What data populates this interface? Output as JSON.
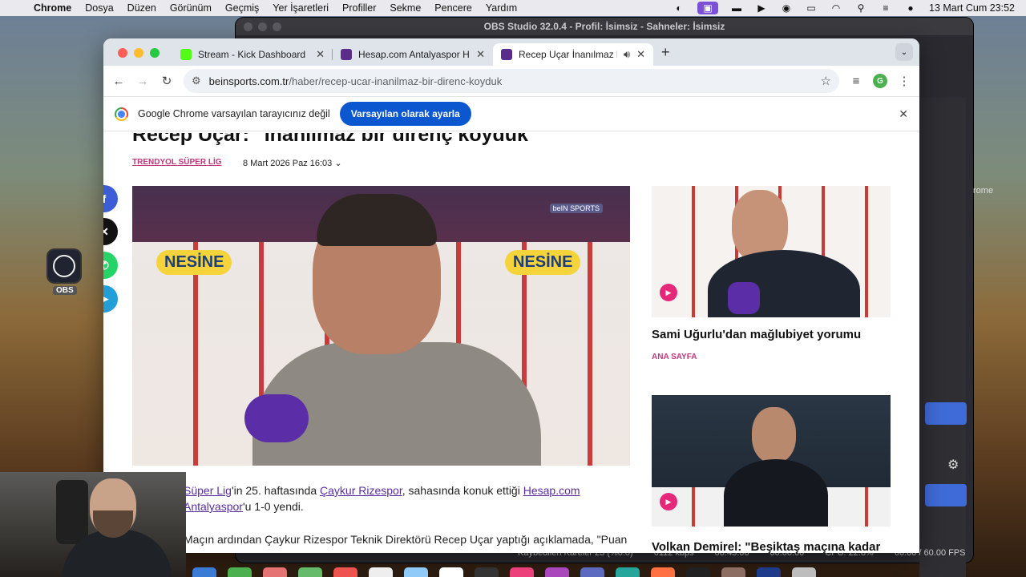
{
  "menubar": {
    "app": "Chrome",
    "items": [
      "Dosya",
      "Düzen",
      "Görünüm",
      "Geçmiş",
      "Yer İşaretleri",
      "Profiller",
      "Sekme",
      "Pencere",
      "Yardım"
    ],
    "datetime": "13 Mart Cum  23:52"
  },
  "obs": {
    "title": "OBS Studio 32.0.4 - Profil: İsimsiz - Sahneler: İsimsiz",
    "source_label": "rome",
    "status": {
      "dropped": "Kaybedilen Kareler 23 (%0.0)",
      "bitrate": "6112 kbps",
      "time": "00:43:06",
      "rec_time": "00:00:00",
      "cpu": "CPU: 22.8%",
      "fps": "60.00 / 60.00 FPS"
    },
    "desktop_icon_label": "OBS"
  },
  "tabs": [
    {
      "title": "Stream - Kick Dashboard",
      "favicon_color": "#53fc18"
    },
    {
      "title": "Hesap.com Antalyaspor Habe",
      "favicon_color": "#5b2d8a"
    },
    {
      "title": "Recep Uçar İnanılmaz bir",
      "favicon_color": "#5b2d8a"
    }
  ],
  "toolbar": {
    "url_host": "beinsports.com.tr",
    "url_path": "/haber/recep-ucar-inanilmaz-bir-direnc-koyduk",
    "profile_initial": "G"
  },
  "infobar": {
    "message": "Google Chrome varsayılan tarayıcınız değil",
    "button": "Varsayılan olarak ayarla"
  },
  "article": {
    "headline": "Recep Uçar: \"İnanılmaz bir direnç koyduk\"",
    "category": "TRENDYOL SÜPER LİG",
    "date": "8 Mart 2026 Paz 16:03",
    "main_image_sponsor": "NESİNE",
    "main_image_tag": "beIN SPORTS",
    "p1_link1": "Süper Lig",
    "p1_text1": "'in 25. haftasında ",
    "p1_link2": "Çaykur Rizespor",
    "p1_text2": ", sahasında konuk ettiği ",
    "p1_link3": "Hesap.com",
    "p2_link": "Antalyaspor",
    "p2_text": "'u 1-0 yendi.",
    "p3_text": "Maçın ardından Çaykur Rizespor Teknik Direktörü Recep Uçar yaptığı açıklamada, \"Puan"
  },
  "sidebar": [
    {
      "title": "Sami Uğurlu'dan mağlubiyet yorumu",
      "category": "ANA SAYFA"
    },
    {
      "title": "Volkan Demirel: \"Beşiktaş maçına kadar",
      "category": ""
    }
  ],
  "share_icons": [
    "facebook-icon",
    "x-icon",
    "whatsapp-icon",
    "telegram-icon"
  ],
  "colors": {
    "accent_blue": "#0b57d0",
    "category_pink": "#c0387a",
    "link_purple": "#5a2ca0"
  }
}
